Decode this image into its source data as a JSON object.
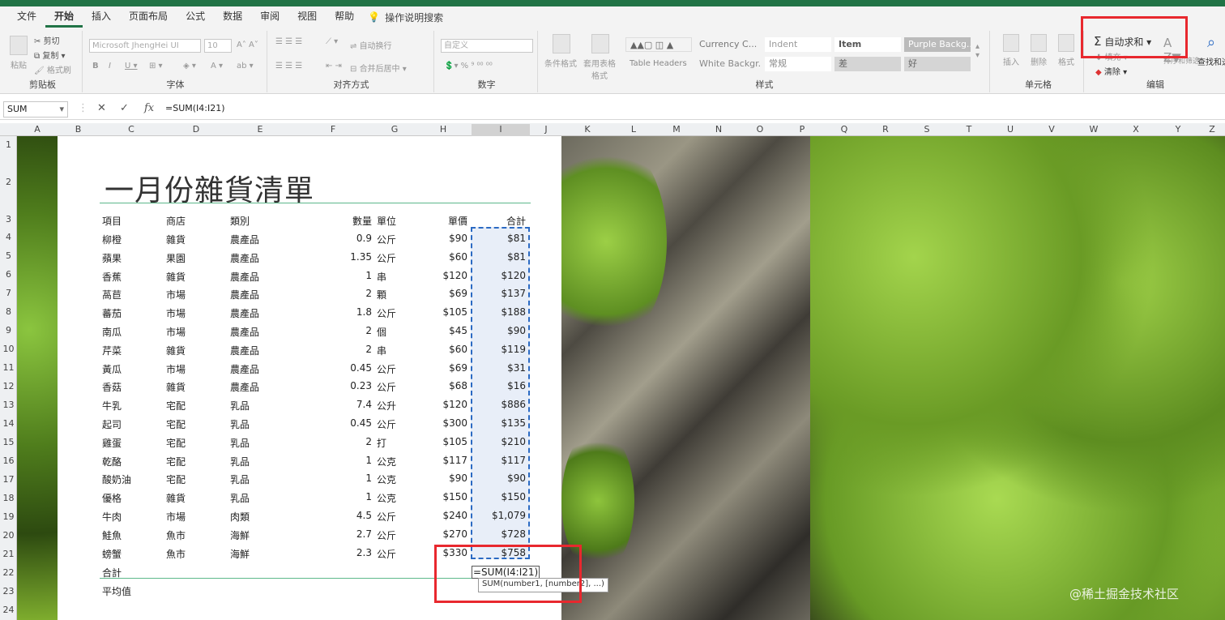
{
  "menu": {
    "tabs": [
      "文件",
      "开始",
      "插入",
      "页面布局",
      "公式",
      "数据",
      "审阅",
      "视图",
      "帮助"
    ],
    "active_tab": "开始",
    "help_search": "操作说明搜索"
  },
  "ribbon": {
    "clipboard": {
      "paste": "粘贴",
      "cut": "剪切",
      "copy": "复制",
      "format_painter": "格式刷",
      "label": "剪贴板"
    },
    "font": {
      "family": "Microsoft JhengHei UI",
      "size": "10",
      "label": "字体"
    },
    "alignment": {
      "wrap": "自动换行",
      "merge": "合并后居中",
      "label": "对齐方式"
    },
    "number": {
      "format": "自定义",
      "label": "数字"
    },
    "styles": {
      "conditional": "条件格式",
      "table_format": "套用表格格式",
      "cells": [
        "Currency C...",
        "Indent",
        "Item",
        "Purple Backg...",
        "Table Headers",
        "White Backgr...",
        "常规",
        "差",
        "好"
      ],
      "label": "样式"
    },
    "cells_group": {
      "insert": "插入",
      "delete": "删除",
      "format": "格式",
      "label": "单元格"
    },
    "editing": {
      "autosum": "自动求和",
      "fill": "填充",
      "clear": "清除",
      "sort": "排序和筛选",
      "find": "查找和选择",
      "label": "编辑"
    }
  },
  "formula_bar": {
    "name_box": "SUM",
    "formula": "=SUM(I4:I21)"
  },
  "columns": [
    "A",
    "B",
    "C",
    "D",
    "E",
    "F",
    "G",
    "H",
    "I",
    "J",
    "K",
    "L",
    "M",
    "N",
    "O",
    "P",
    "Q",
    "R",
    "S",
    "T",
    "U",
    "V",
    "W",
    "X",
    "Y",
    "Z"
  ],
  "rows": [
    "1",
    "2",
    "3",
    "4",
    "5",
    "6",
    "7",
    "8",
    "9",
    "10",
    "11",
    "12",
    "13",
    "14",
    "15",
    "16",
    "17",
    "18",
    "19",
    "20",
    "21",
    "22",
    "23",
    "24"
  ],
  "sheet": {
    "title": "一月份雜貨清單",
    "headers": {
      "item": "項目",
      "store": "商店",
      "category": "類別",
      "qty": "數量",
      "unit": "單位",
      "price": "單價",
      "total": "合計"
    },
    "rows": [
      {
        "item": "柳橙",
        "store": "雜貨",
        "category": "農產品",
        "qty": "0.9",
        "unit": "公斤",
        "price": "$90",
        "total": "$81"
      },
      {
        "item": "蘋果",
        "store": "果園",
        "category": "農產品",
        "qty": "1.35",
        "unit": "公斤",
        "price": "$60",
        "total": "$81"
      },
      {
        "item": "香蕉",
        "store": "雜貨",
        "category": "農產品",
        "qty": "1",
        "unit": "串",
        "price": "$120",
        "total": "$120"
      },
      {
        "item": "萵苣",
        "store": "市場",
        "category": "農產品",
        "qty": "2",
        "unit": "顆",
        "price": "$69",
        "total": "$137"
      },
      {
        "item": "蕃茄",
        "store": "市場",
        "category": "農產品",
        "qty": "1.8",
        "unit": "公斤",
        "price": "$105",
        "total": "$188"
      },
      {
        "item": "南瓜",
        "store": "市場",
        "category": "農產品",
        "qty": "2",
        "unit": "個",
        "price": "$45",
        "total": "$90"
      },
      {
        "item": "芹菜",
        "store": "雜貨",
        "category": "農產品",
        "qty": "2",
        "unit": "串",
        "price": "$60",
        "total": "$119"
      },
      {
        "item": "黃瓜",
        "store": "市場",
        "category": "農產品",
        "qty": "0.45",
        "unit": "公斤",
        "price": "$69",
        "total": "$31"
      },
      {
        "item": "香菇",
        "store": "雜貨",
        "category": "農產品",
        "qty": "0.23",
        "unit": "公斤",
        "price": "$68",
        "total": "$16"
      },
      {
        "item": "牛乳",
        "store": "宅配",
        "category": "乳品",
        "qty": "7.4",
        "unit": "公升",
        "price": "$120",
        "total": "$886"
      },
      {
        "item": "起司",
        "store": "宅配",
        "category": "乳品",
        "qty": "0.45",
        "unit": "公斤",
        "price": "$300",
        "total": "$135"
      },
      {
        "item": "雞蛋",
        "store": "宅配",
        "category": "乳品",
        "qty": "2",
        "unit": "打",
        "price": "$105",
        "total": "$210"
      },
      {
        "item": "乾酪",
        "store": "宅配",
        "category": "乳品",
        "qty": "1",
        "unit": "公克",
        "price": "$117",
        "total": "$117"
      },
      {
        "item": "酸奶油",
        "store": "宅配",
        "category": "乳品",
        "qty": "1",
        "unit": "公克",
        "price": "$90",
        "total": "$90"
      },
      {
        "item": "優格",
        "store": "雜貨",
        "category": "乳品",
        "qty": "1",
        "unit": "公克",
        "price": "$150",
        "total": "$150"
      },
      {
        "item": "牛肉",
        "store": "市場",
        "category": "肉類",
        "qty": "4.5",
        "unit": "公斤",
        "price": "$240",
        "total": "$1,079"
      },
      {
        "item": "鮭魚",
        "store": "魚市",
        "category": "海鮮",
        "qty": "2.7",
        "unit": "公斤",
        "price": "$270",
        "total": "$728"
      },
      {
        "item": "螃蟹",
        "store": "魚市",
        "category": "海鮮",
        "qty": "2.3",
        "unit": "公斤",
        "price": "$330",
        "total": "$758"
      }
    ],
    "total_label": "合計",
    "avg_label": "平均值",
    "editing_formula": "=SUM(I4:I21)",
    "tooltip": "SUM(number1, [number2], ...)"
  },
  "watermark": "@稀土掘金技术社区",
  "colors": {
    "accent": "#217346",
    "highlight": "#e8282e",
    "selection": "#2b6ac3"
  }
}
